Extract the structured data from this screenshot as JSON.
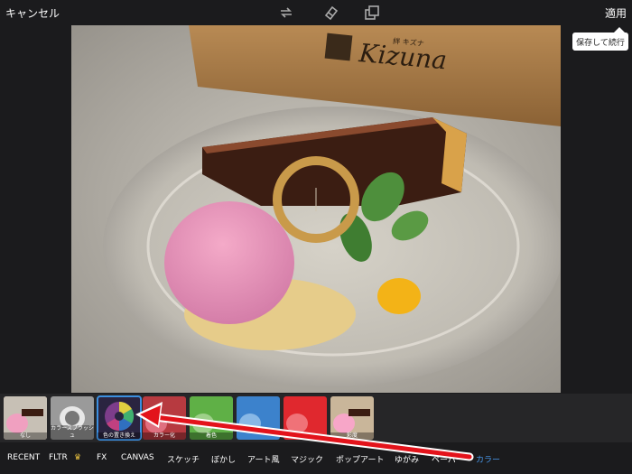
{
  "topbar": {
    "cancel_label": "キャンセル",
    "apply_label": "適用",
    "tooltip": "保存して続行",
    "icons": [
      "redo-icon",
      "eraser-icon",
      "layers-icon"
    ]
  },
  "photo": {
    "sign_text": "Kizuna",
    "sign_subtext": "絆 キズナ"
  },
  "filters": [
    {
      "label": "なし",
      "icon": "dessert-thumbnail"
    },
    {
      "label": "カラースプラッシュ",
      "icon": "dessert-thumbnail"
    },
    {
      "label": "色の置き換え",
      "icon": "color-wheel-icon",
      "selected": true
    },
    {
      "label": "カラー化",
      "icon": "dessert-thumbnail"
    },
    {
      "label": "着色",
      "icon": "dessert-thumbnail"
    },
    {
      "label": "",
      "icon": "dessert-thumbnail"
    },
    {
      "label": "",
      "icon": "dessert-thumbnail"
    },
    {
      "label": "彩度",
      "icon": "dessert-thumbnail"
    }
  ],
  "categories": [
    {
      "label": "RECENT"
    },
    {
      "label": "FLTR"
    },
    {
      "label": "FX"
    },
    {
      "label": "CANVAS"
    },
    {
      "label": "スケッチ"
    },
    {
      "label": "ぼかし"
    },
    {
      "label": "アート風"
    },
    {
      "label": "マジック"
    },
    {
      "label": "ポップアート"
    },
    {
      "label": "ゆがみ"
    },
    {
      "label": "ペーパー"
    },
    {
      "label": "カラー",
      "active": true
    }
  ],
  "colors": {
    "accent": "#4a9bf0",
    "annotation_arrow": "#e3131b",
    "selected_ring": "#c99a4a"
  }
}
